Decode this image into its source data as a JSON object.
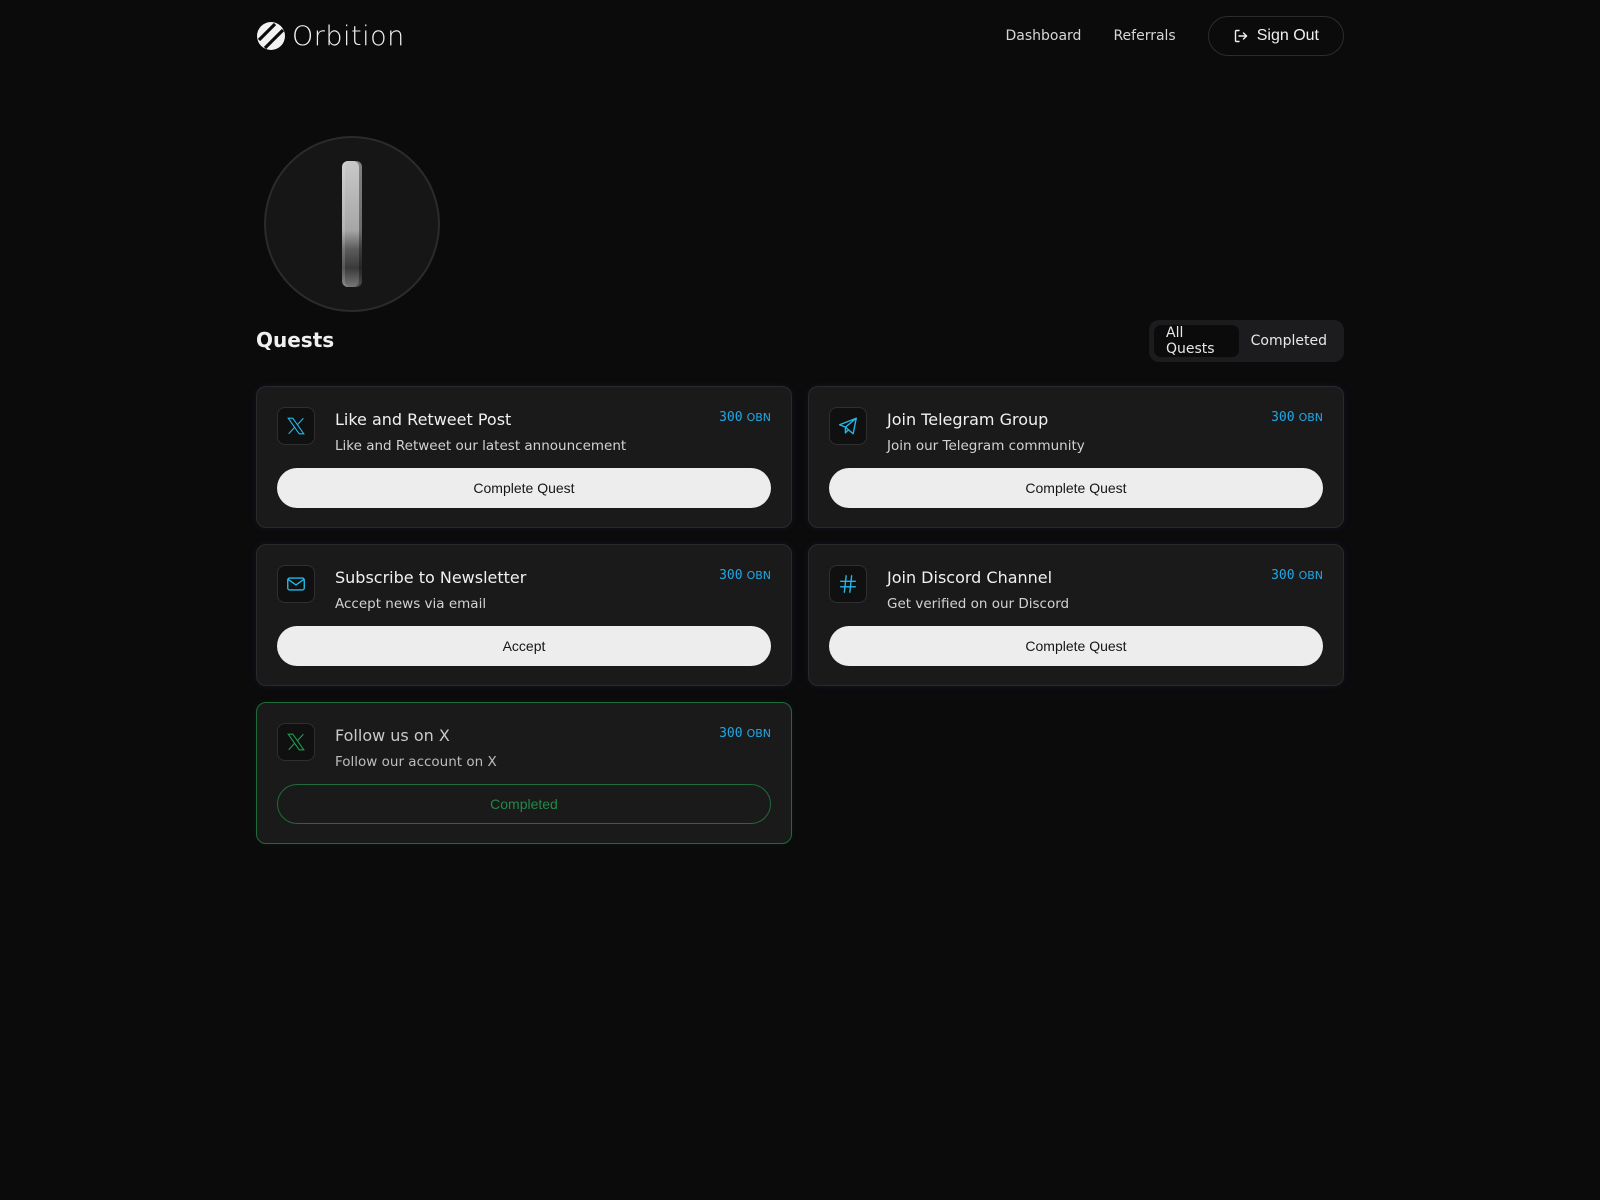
{
  "brand": {
    "name": "Orbition"
  },
  "nav": {
    "links": [
      "Dashboard",
      "Referrals"
    ],
    "sign_out_label": "Sign Out"
  },
  "quests": {
    "title": "Quests",
    "filters": [
      "All Quests",
      "Completed"
    ],
    "active_filter": "All Quests",
    "items": [
      {
        "icon": "x-logo-icon",
        "title": "Like and Retweet Post",
        "description": "Like and Retweet our latest announcement",
        "reward_amount": "300",
        "reward_unit": "OBN",
        "action_label": "Complete Quest",
        "completed": false
      },
      {
        "icon": "telegram-icon",
        "title": "Join Telegram Group",
        "description": "Join our Telegram community",
        "reward_amount": "300",
        "reward_unit": "OBN",
        "action_label": "Complete Quest",
        "completed": false
      },
      {
        "icon": "mail-icon",
        "title": "Subscribe to Newsletter",
        "description": "Accept news via email",
        "reward_amount": "300",
        "reward_unit": "OBN",
        "action_label": "Accept",
        "completed": false
      },
      {
        "icon": "hash-icon",
        "title": "Join Discord Channel",
        "description": "Get verified on our Discord",
        "reward_amount": "300",
        "reward_unit": "OBN",
        "action_label": "Complete Quest",
        "completed": false
      },
      {
        "icon": "x-logo-icon",
        "title": "Follow us on X",
        "description": "Follow our account on X",
        "reward_amount": "300",
        "reward_unit": "OBN",
        "action_label": "Completed",
        "completed": true
      }
    ]
  },
  "colors": {
    "background": "#0b0b0c",
    "card": "#1a1a1b",
    "accent": "#22a7e6",
    "completed": "#1f8a46"
  }
}
